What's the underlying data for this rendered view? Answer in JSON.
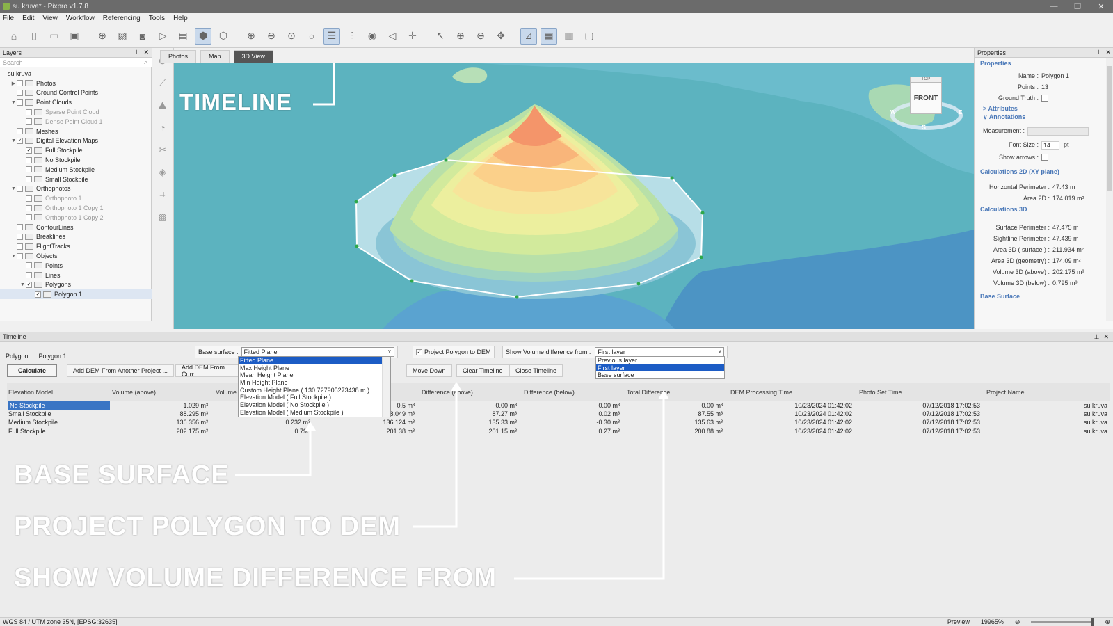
{
  "window": {
    "title": "su kruva* - Pixpro v1.7.8"
  },
  "menu": [
    "File",
    "Edit",
    "View",
    "Workflow",
    "Referencing",
    "Tools",
    "Help"
  ],
  "layers": {
    "title": "Layers",
    "search_placeholder": "Search",
    "items": [
      {
        "label": "su kruva",
        "level": 0,
        "checkbox": false,
        "twisty": ""
      },
      {
        "label": "Photos",
        "level": 1,
        "checkbox": true,
        "checked": false,
        "twisty": "▶"
      },
      {
        "label": "Ground Control Points",
        "level": 1,
        "checkbox": true,
        "checked": false,
        "twisty": ""
      },
      {
        "label": "Point Clouds",
        "level": 1,
        "checkbox": true,
        "checked": false,
        "twisty": "▼"
      },
      {
        "label": "Sparse Point Cloud",
        "level": 2,
        "checkbox": true,
        "checked": false,
        "twisty": "",
        "dim": true
      },
      {
        "label": "Dense Point Cloud 1",
        "level": 2,
        "checkbox": true,
        "checked": false,
        "twisty": "",
        "dim": true
      },
      {
        "label": "Meshes",
        "level": 1,
        "checkbox": true,
        "checked": false,
        "twisty": ""
      },
      {
        "label": "Digital Elevation Maps",
        "level": 1,
        "checkbox": true,
        "checked": true,
        "twisty": "▼"
      },
      {
        "label": "Full Stockpile",
        "level": 2,
        "checkbox": true,
        "checked": true,
        "twisty": ""
      },
      {
        "label": "No Stockpile",
        "level": 2,
        "checkbox": true,
        "checked": false,
        "twisty": ""
      },
      {
        "label": "Medium Stockpile",
        "level": 2,
        "checkbox": true,
        "checked": false,
        "twisty": ""
      },
      {
        "label": "Small Stockpile",
        "level": 2,
        "checkbox": true,
        "checked": false,
        "twisty": ""
      },
      {
        "label": "Orthophotos",
        "level": 1,
        "checkbox": true,
        "checked": false,
        "twisty": "▼"
      },
      {
        "label": "Orthophoto 1",
        "level": 2,
        "checkbox": true,
        "checked": false,
        "twisty": "",
        "dim": true
      },
      {
        "label": "Orthophoto 1 Copy 1",
        "level": 2,
        "checkbox": true,
        "checked": false,
        "twisty": "",
        "dim": true
      },
      {
        "label": "Orthophoto 1 Copy 2",
        "level": 2,
        "checkbox": true,
        "checked": false,
        "twisty": "",
        "dim": true
      },
      {
        "label": "ContourLines",
        "level": 1,
        "checkbox": true,
        "checked": false,
        "twisty": ""
      },
      {
        "label": "Breaklines",
        "level": 1,
        "checkbox": true,
        "checked": false,
        "twisty": ""
      },
      {
        "label": "FlightTracks",
        "level": 1,
        "checkbox": true,
        "checked": false,
        "twisty": ""
      },
      {
        "label": "Objects",
        "level": 1,
        "checkbox": true,
        "checked": false,
        "twisty": "▼"
      },
      {
        "label": "Points",
        "level": 2,
        "checkbox": true,
        "checked": false,
        "twisty": ""
      },
      {
        "label": "Lines",
        "level": 2,
        "checkbox": true,
        "checked": false,
        "twisty": ""
      },
      {
        "label": "Polygons",
        "level": 2,
        "checkbox": true,
        "checked": true,
        "twisty": "▼"
      },
      {
        "label": "Polygon 1",
        "level": 3,
        "checkbox": true,
        "checked": true,
        "twisty": "",
        "selected": true
      }
    ]
  },
  "view_tabs": [
    "Photos",
    "Map",
    "3D View"
  ],
  "view_cube": {
    "front": "FRONT",
    "top": "TOP",
    "south": "S",
    "west": "W",
    "east": "E"
  },
  "properties": {
    "title": "Properties",
    "section": "Properties",
    "name_label": "Name :",
    "name_value": "Polygon 1",
    "points_label": "Points :",
    "points_value": "13",
    "ground_truth_label": "Ground Truth :",
    "attributes": "Attributes",
    "annotations": "Annotations",
    "measurement_label": "Measurement :",
    "font_size_label": "Font Size :",
    "font_size_value": "14",
    "font_unit": "pt",
    "show_arrows_label": "Show arrows :",
    "calc2d": "Calculations 2D (XY plane)",
    "hperim_label": "Horizontal Perimeter :",
    "hperim_value": "47.43 m",
    "area2d_label": "Area 2D :",
    "area2d_value": "174.019 m²",
    "calc3d": "Calculations 3D",
    "sperim_label": "Surface Perimeter :",
    "sperim_value": "47.475 m",
    "slperim_label": "Sightline Perimeter :",
    "slperim_value": "47.439 m",
    "area3ds_label": "Area 3D ( surface ) :",
    "area3ds_value": "211.934 m²",
    "area3dg_label": "Area 3D (geometry) :",
    "area3dg_value": "174.09 m²",
    "vol_above_label": "Volume 3D (above) :",
    "vol_above_value": "202.175 m³",
    "vol_below_label": "Volume 3D (below) :",
    "vol_below_value": "0.795 m³",
    "base_surface": "Base Surface"
  },
  "timeline": {
    "title": "Timeline",
    "polygon_label": "Polygon :",
    "polygon_value": "Polygon 1",
    "base_label": "Base surface :",
    "base_value": "Fitted Plane",
    "base_options": [
      "Fitted Plane",
      "Max Height Plane",
      "Mean Height Plane",
      "Min Height Plane",
      "Custom Height Plane ( 130.727905273438 m )",
      "Elevation Model ( Full Stockpile )",
      "Elevation Model ( No Stockpile )",
      "Elevation Model ( Medium Stockpile )"
    ],
    "project_label": "Project Polygon to DEM",
    "show_label": "Show Volume difference from :",
    "show_value": "First layer",
    "show_options": [
      "Previous layer",
      "First layer",
      "Base surface"
    ],
    "buttons": {
      "calculate": "Calculate",
      "add_dem_other": "Add DEM From Another Project ...",
      "add_dem_current": "Add DEM From Curr",
      "move_down": "Move Down",
      "clear": "Clear Timeline",
      "close": "Close Timeline"
    },
    "columns": [
      "Elevation Model",
      "Volume (above)",
      "Volume",
      "Difference (above)",
      "Difference (below)",
      "Total Difference",
      "DEM Processing Time",
      "Photo Set Time",
      "Project Name"
    ],
    "rows": [
      {
        "model": "No Stockpile",
        "vabove": "1.029 m³",
        "vbelow": "",
        "vtotal": "0.5 m³",
        "dabove": "0.00 m³",
        "dbelow": "0.00 m³",
        "dtotal": "0.00 m³",
        "dem": "10/23/2024 01:42:02",
        "photo": "07/12/2018 17:02:53",
        "project": "su kruva"
      },
      {
        "model": "Small Stockpile",
        "vabove": "88.295 m³",
        "vbelow": "",
        "vtotal": "8.049 m³",
        "dabove": "87.27 m³",
        "dbelow": "0.02 m³",
        "dtotal": "87.55 m³",
        "dem": "10/23/2024 01:42:02",
        "photo": "07/12/2018 17:02:53",
        "project": "su kruva"
      },
      {
        "model": "Medium Stockpile",
        "vabove": "136.356 m³",
        "vbelow": "0.232 m³",
        "vtotal": "136.124 m³",
        "dabove": "135.33 m³",
        "dbelow": "-0.30 m³",
        "dtotal": "135.63 m³",
        "dem": "10/23/2024 01:42:02",
        "photo": "07/12/2018 17:02:53",
        "project": "su kruva"
      },
      {
        "model": "Full Stockpile",
        "vabove": "202.175 m³",
        "vbelow": "0.795",
        "vtotal": "201.38 m³",
        "dabove": "201.15 m³",
        "dbelow": "0.27 m³",
        "dtotal": "200.88 m³",
        "dem": "10/23/2024 01:42:02",
        "photo": "07/12/2018 17:02:53",
        "project": "su kruva"
      }
    ]
  },
  "annotations": {
    "timeline": "TIMELINE",
    "base_surface": "BASE SURFACE",
    "project_polygon": "PROJECT POLYGON TO DEM",
    "show_volume": "SHOW VOLUME DIFFERENCE FROM"
  },
  "status": {
    "crs": "WGS 84 / UTM zone 35N, [EPSG:32635]",
    "preview": "Preview",
    "zoom": "19965%"
  }
}
